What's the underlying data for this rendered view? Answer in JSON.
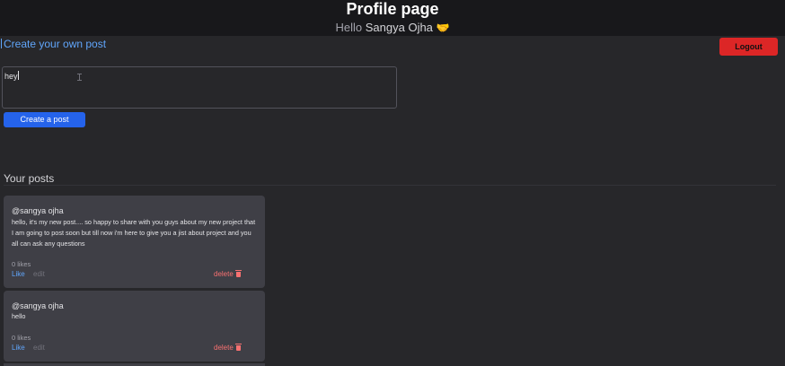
{
  "header": {
    "title": "Profile page",
    "greeting_prefix": "Hello",
    "user_name": "Sangya Ojha",
    "greeting_emoji": "🤝"
  },
  "logout_label": "Logout",
  "create": {
    "heading": "Create your own post",
    "textarea_value": "hey",
    "submit_label": "Create a post"
  },
  "posts_heading": "Your posts",
  "posts": [
    {
      "user": "@sangya ojha",
      "content": "hello, it's my new post.... so happy to share with you guys about my new project that I am going to post soon but till now i'm here to give you a jist about project and you all can ask any questions",
      "likes": "0 likes",
      "like_label": "Like",
      "edit_label": "edit",
      "delete_label": "delete"
    },
    {
      "user": "@sangya ojha",
      "content": "hello",
      "likes": "0 likes",
      "like_label": "Like",
      "edit_label": "edit",
      "delete_label": "delete"
    }
  ],
  "colors": {
    "background": "#27272a",
    "header": "#18181b",
    "card": "#3f3f46",
    "accent": "#2563eb",
    "link": "#60a5fa",
    "danger": "#dc2626"
  }
}
